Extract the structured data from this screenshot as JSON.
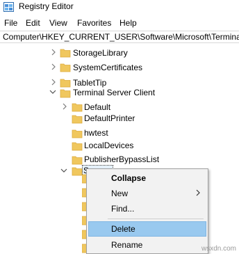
{
  "window": {
    "title": "Registry Editor",
    "app_icon": "registry-editor-icon"
  },
  "menu": {
    "items": [
      "File",
      "Edit",
      "View",
      "Favorites",
      "Help"
    ]
  },
  "address": {
    "path": "Computer\\HKEY_CURRENT_USER\\Software\\Microsoft\\Terminal Se"
  },
  "tree": {
    "rows": [
      {
        "label": "StorageLibrary",
        "expander": "collapsed"
      },
      {
        "label": "SystemCertificates",
        "expander": "collapsed"
      },
      {
        "label": "TabletTip",
        "expander": "collapsed"
      },
      {
        "label": "Terminal Server Client",
        "expander": "expanded"
      },
      {
        "label": "Default",
        "expander": "collapsed"
      },
      {
        "label": "DefaultPrinter",
        "expander": "none"
      },
      {
        "label": "hwtest",
        "expander": "none"
      },
      {
        "label": "LocalDevices",
        "expander": "none"
      },
      {
        "label": "PublisherBypassList",
        "expander": "none"
      },
      {
        "label": "Servers",
        "expander": "expanded",
        "selected": true
      }
    ]
  },
  "context_menu": {
    "items": [
      {
        "label": "Collapse",
        "bold": true
      },
      {
        "label": "New",
        "submenu": true
      },
      {
        "label": "Find..."
      },
      {
        "label": "Delete",
        "highlighted": true
      },
      {
        "label": "Rename"
      }
    ]
  },
  "watermark": "wsxdn.com",
  "colors": {
    "folder": "#f0c75e",
    "folder_dark": "#dcaa3c",
    "highlight": "#99c9ef",
    "menu_bg": "#f2f2f2"
  }
}
